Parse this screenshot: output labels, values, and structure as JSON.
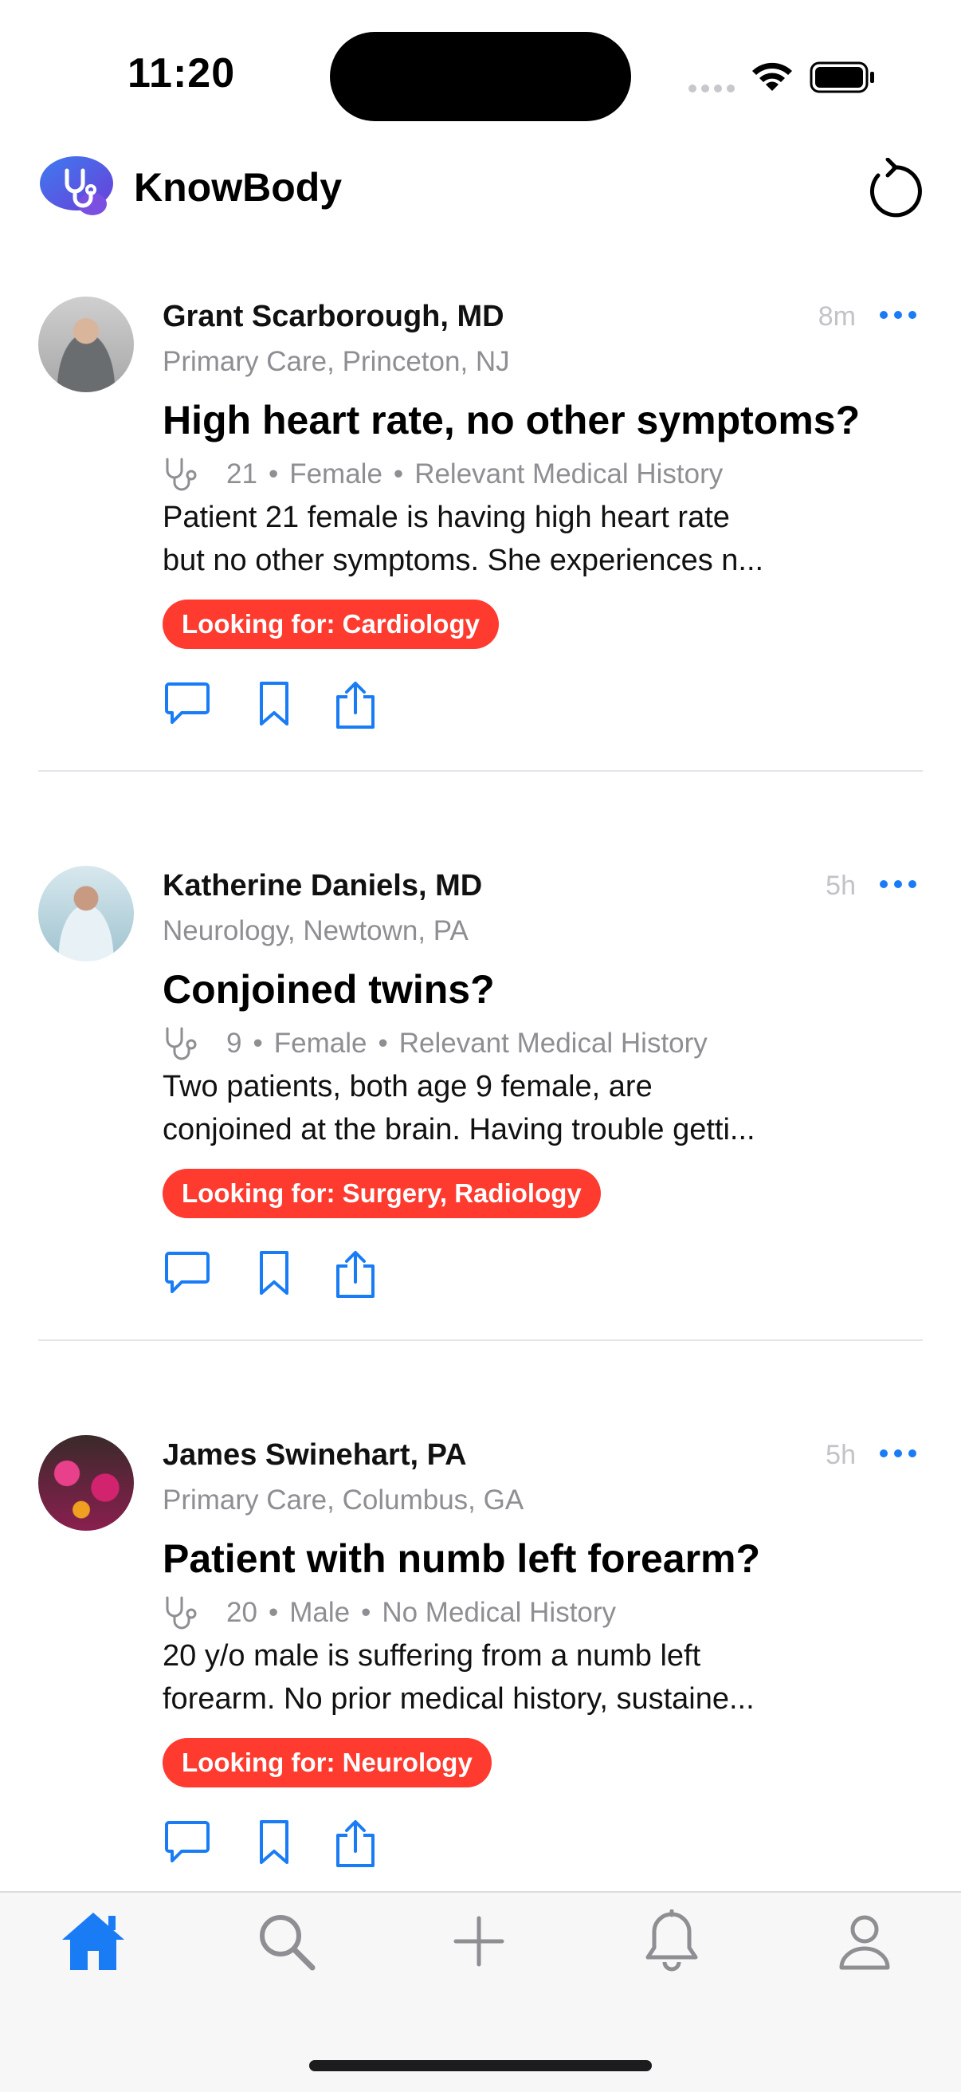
{
  "status_bar": {
    "time": "11:20"
  },
  "header": {
    "app_name": "KnowBody"
  },
  "posts": [
    {
      "author": "Grant Scarborough, MD",
      "meta": "Primary Care, Princeton, NJ",
      "time": "8m",
      "title": "High heart rate, no other symptoms?",
      "age": "21",
      "sex": "Female",
      "history": "Relevant Medical History",
      "body_line1": "Patient 21 female is having high heart rate",
      "body_line2": "but no other symptoms. She experiences n...",
      "tag": "Looking for: Cardiology"
    },
    {
      "author": "Katherine Daniels, MD",
      "meta": "Neurology, Newtown, PA",
      "time": "5h",
      "title": "Conjoined twins?",
      "age": "9",
      "sex": "Female",
      "history": "Relevant Medical History",
      "body_line1": "Two patients, both age 9 female, are",
      "body_line2": "conjoined at the brain. Having trouble getti...",
      "tag": "Looking for: Surgery, Radiology"
    },
    {
      "author": "James Swinehart, PA",
      "meta": "Primary Care, Columbus, GA",
      "time": "5h",
      "title": "Patient with numb left forearm?",
      "age": "20",
      "sex": "Male",
      "history": "No Medical History",
      "body_line1": "20 y/o male is suffering from a numb left",
      "body_line2": "forearm. No prior medical history, sustaine...",
      "tag": "Looking for: Neurology"
    }
  ],
  "info_separator": "•",
  "colors": {
    "accent": "#1a7cf5",
    "tag": "#ff3b30",
    "secondary_text": "#8e8e93"
  },
  "tab_bar": {
    "tabs": [
      {
        "icon": "home-icon",
        "selected": true
      },
      {
        "icon": "search-icon",
        "selected": false
      },
      {
        "icon": "plus-icon",
        "selected": false
      },
      {
        "icon": "bell-icon",
        "selected": false
      },
      {
        "icon": "person-icon",
        "selected": false
      }
    ]
  }
}
